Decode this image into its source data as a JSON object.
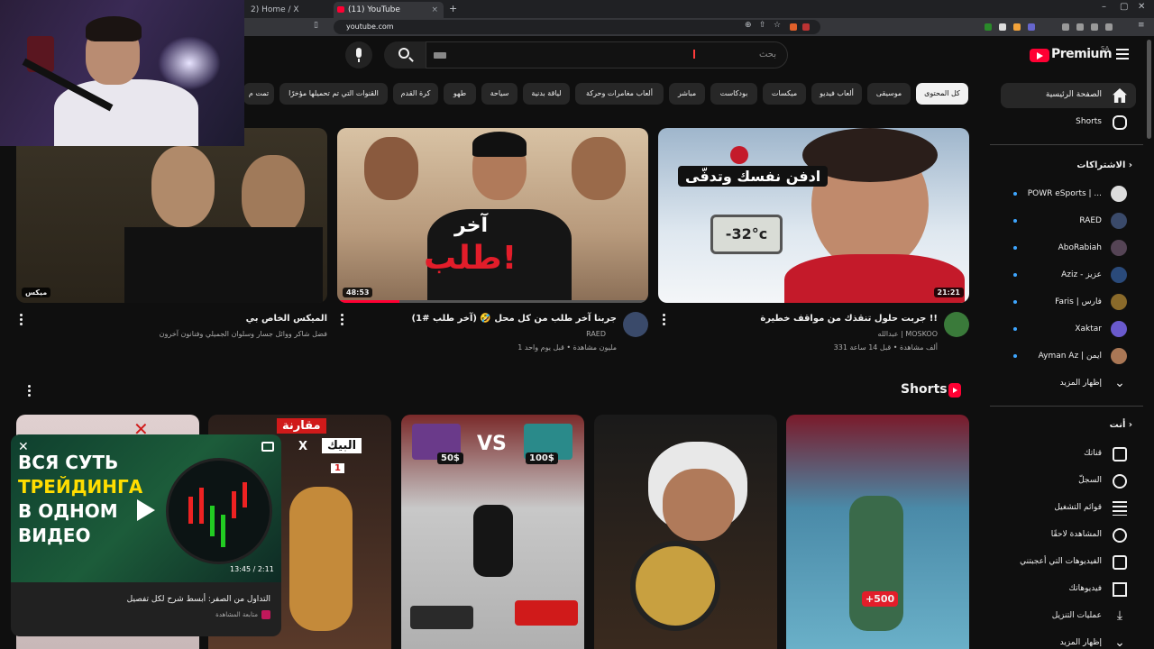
{
  "browser": {
    "tab_inactive": "2) Home / X",
    "tab_active": "(11) YouTube",
    "tab_close": "×",
    "new_tab": "+",
    "url": "youtube.com",
    "win_min": "–",
    "win_max": "▢",
    "win_close": "✕"
  },
  "masthead": {
    "logo_text": "Premium",
    "logo_country": "SA",
    "search_placeholder": "بحث"
  },
  "chips": [
    {
      "label": "كل المحتوى",
      "active": true
    },
    {
      "label": "موسيقى"
    },
    {
      "label": "ألعاب فيديو"
    },
    {
      "label": "ميكسات"
    },
    {
      "label": "بودكاست"
    },
    {
      "label": "مباشر"
    },
    {
      "label": "ألعاب مغامرات وحركة"
    },
    {
      "label": "لياقة بدنية"
    },
    {
      "label": "سياحة"
    },
    {
      "label": "طهو"
    },
    {
      "label": "كرة القدم"
    },
    {
      "label": "القنوات التي تم تحميلها مؤخرًا"
    },
    {
      "label": "تمت م"
    }
  ],
  "sidebar": {
    "main": [
      {
        "label": "الصفحة الرئيسية",
        "icon": "home-icon"
      },
      {
        "label": "Shorts",
        "icon": "shorts-icon"
      }
    ],
    "subscriptions_title": "الاشتراكات",
    "subscriptions": [
      {
        "label": "POWR eSports | ...",
        "color": "#dddddd"
      },
      {
        "label": "RAED",
        "color": "#3a4a6a"
      },
      {
        "label": "AboRabiah",
        "color": "#554455"
      },
      {
        "label": "Aziz - عزيز",
        "color": "#2a4a7a"
      },
      {
        "label": "Faris | فارس",
        "color": "#8a6a2a"
      },
      {
        "label": "Xaktar",
        "color": "#6a5acd"
      },
      {
        "label": "Ayman Az | ايمن",
        "color": "#aa7755"
      }
    ],
    "show_more": "إظهار المزيد",
    "you_title": "أنت",
    "you_items": [
      {
        "label": "قناتك",
        "icon": "account-icon"
      },
      {
        "label": "السجلّ",
        "icon": "history-icon"
      },
      {
        "label": "قوائم التشغيل",
        "icon": "playlist-icon"
      },
      {
        "label": "المشاهدة لاحقًا",
        "icon": "watch-later-icon"
      },
      {
        "label": "الفيديوهات التي أعجبتني",
        "icon": "like-icon"
      },
      {
        "label": "فيديوهاتك",
        "icon": "your-videos-icon"
      },
      {
        "label": "عمليات التنزيل",
        "icon": "download-icon"
      }
    ],
    "show_more_2": "إظهار المزيد"
  },
  "videos": [
    {
      "title": "جربت حلول تنقذك من مواقف خطيرة !!",
      "channel": "عبدالله | MOSKOO",
      "meta": "331 ألف مشاهدة • قبل 14 ساعة",
      "duration": "21:21",
      "overlay": "ادفن نفسك وتدفّى",
      "temp": "-32°c"
    },
    {
      "title": "جربنا آخر طلب من كل محل 🤣 (آخر طلب #1)",
      "channel": "RAED",
      "meta": "1 مليون مشاهدة • قبل يوم واحد",
      "duration": "48:53",
      "overlay1": "آخر",
      "overlay2": "طلب!"
    },
    {
      "title": "الميكس الخاص بي",
      "channel": "فضل شاكر ووائل جسار وسلوان الجميلي وفنانون آخرون",
      "badge": "ميكس"
    }
  ],
  "shorts": {
    "title": "Shorts",
    "items": [
      {
        "badge": "+500"
      },
      {},
      {
        "left_price": "50$",
        "right_price": "100$",
        "vs": "VS"
      },
      {
        "label": "البيك",
        "x": "X",
        "top": "مقارنة",
        "num": "1"
      },
      {}
    ]
  },
  "miniplayer": {
    "title": "التداول من الصفر: أبسط شرح لكل تفصيل",
    "channel": "متابعة المشاهدة",
    "time": "13:45 / 2:11",
    "overlay_lines": [
      "ВСЯ СУТЬ",
      "ТРЕЙДИНГА",
      "В ОДНОМ",
      "ВИДЕО"
    ],
    "close": "✕"
  }
}
